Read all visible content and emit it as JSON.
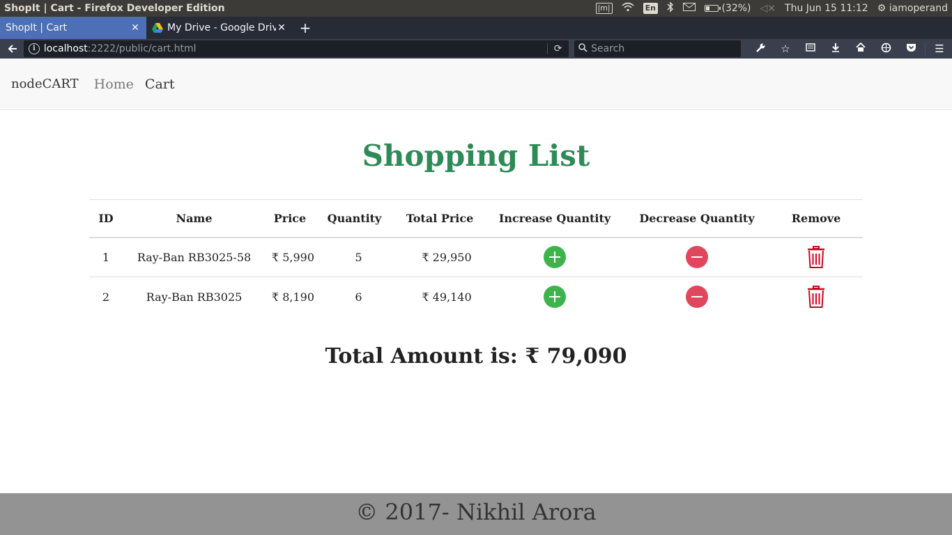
{
  "os": {
    "window_title": "ShopIt | Cart - Firefox Developer Edition",
    "keyboard": "En",
    "battery": "(32%)",
    "battery_level": 0.32,
    "datetime": "Thu Jun 15 11:12",
    "user": "iamoperand"
  },
  "tabs": [
    {
      "label": "ShopIt | Cart",
      "active": true
    },
    {
      "label": "My Drive - Google Drive",
      "active": false
    }
  ],
  "address": {
    "host": "localhost",
    "path": ":2222/public/cart.html",
    "search_placeholder": "Search"
  },
  "site": {
    "brand": "nodeCART",
    "nav": [
      "Home",
      "Cart"
    ]
  },
  "heading": "Shopping List",
  "table": {
    "headers": [
      "ID",
      "Name",
      "Price",
      "Quantity",
      "Total Price",
      "Increase Quantity",
      "Decrease Quantity",
      "Remove"
    ],
    "rows": [
      {
        "id": "1",
        "name": "Ray-Ban RB3025-58",
        "price": "₹ 5,990",
        "quantity": "5",
        "total": "₹ 29,950"
      },
      {
        "id": "2",
        "name": "Ray-Ban RB3025",
        "price": "₹ 8,190",
        "quantity": "6",
        "total": "₹ 49,140"
      }
    ]
  },
  "total_amount": "Total Amount is: ₹ 79,090",
  "footer": "© 2017- Nikhil Arora",
  "colors": {
    "heading": "#2e8b57",
    "increase": "#3cb44b",
    "decrease": "#e0475c",
    "remove": "#d0021b"
  }
}
